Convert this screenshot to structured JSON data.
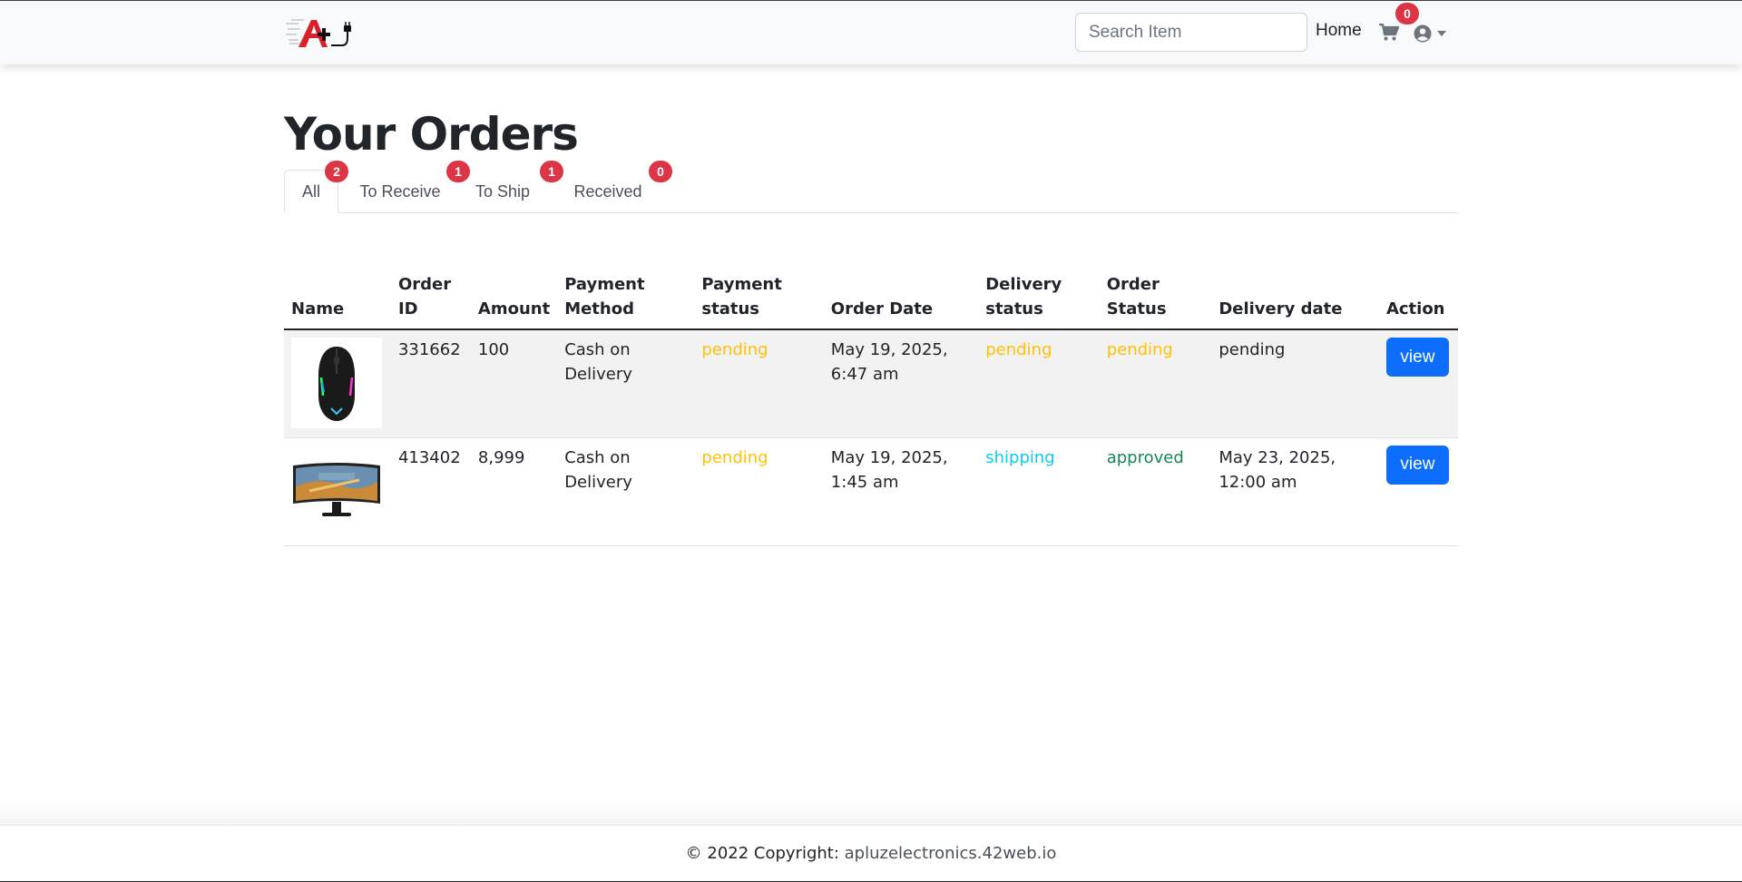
{
  "navbar": {
    "logo_text": "A+",
    "search": {
      "placeholder": "Search Item",
      "value": ""
    },
    "home_label": "Home",
    "cart_count": "0"
  },
  "main": {
    "title": "Your Orders",
    "tabs": [
      {
        "label": "All",
        "count": "2",
        "active": true
      },
      {
        "label": "To Receive",
        "count": "1",
        "active": false
      },
      {
        "label": "To Ship",
        "count": "1",
        "active": false
      },
      {
        "label": "Received",
        "count": "0",
        "active": false
      }
    ],
    "table": {
      "headers": {
        "name": "Name",
        "order_id_1": "Order",
        "order_id_2": "ID",
        "amount": "Amount",
        "payment_method_1": "Payment",
        "payment_method_2": "Method",
        "payment_status_1": "Payment",
        "payment_status_2": "status",
        "order_date": "Order Date",
        "delivery_status_1": "Delivery",
        "delivery_status_2": "status",
        "order_status_1": "Order",
        "order_status_2": "Status",
        "delivery_date": "Delivery date",
        "action": "Action"
      },
      "rows": [
        {
          "product_icon": "gaming-mouse-image",
          "order_id": "331662",
          "amount": "100",
          "payment_method": "Cash on Delivery",
          "payment_status": "pending",
          "order_date": "May 19, 2025, 6:47 am",
          "delivery_status": "pending",
          "order_status": "pending",
          "delivery_date": "pending",
          "action_label": "view"
        },
        {
          "product_icon": "monitor-image",
          "order_id": "413402",
          "amount": "8,999",
          "payment_method": "Cash on Delivery",
          "payment_status": "pending",
          "order_date": "May 19, 2025, 1:45 am",
          "delivery_status": "shipping",
          "order_status": "approved",
          "delivery_date": "May 23, 2025, 12:00 am",
          "action_label": "view"
        }
      ]
    }
  },
  "footer": {
    "copyright": "© 2022 Copyright: ",
    "site": "apluzelectronics.42web.io"
  },
  "colors": {
    "primary": "#0d6efd",
    "danger": "#dc3545",
    "warning": "#ffc107",
    "info": "#0dcaf0",
    "success": "#198754"
  }
}
